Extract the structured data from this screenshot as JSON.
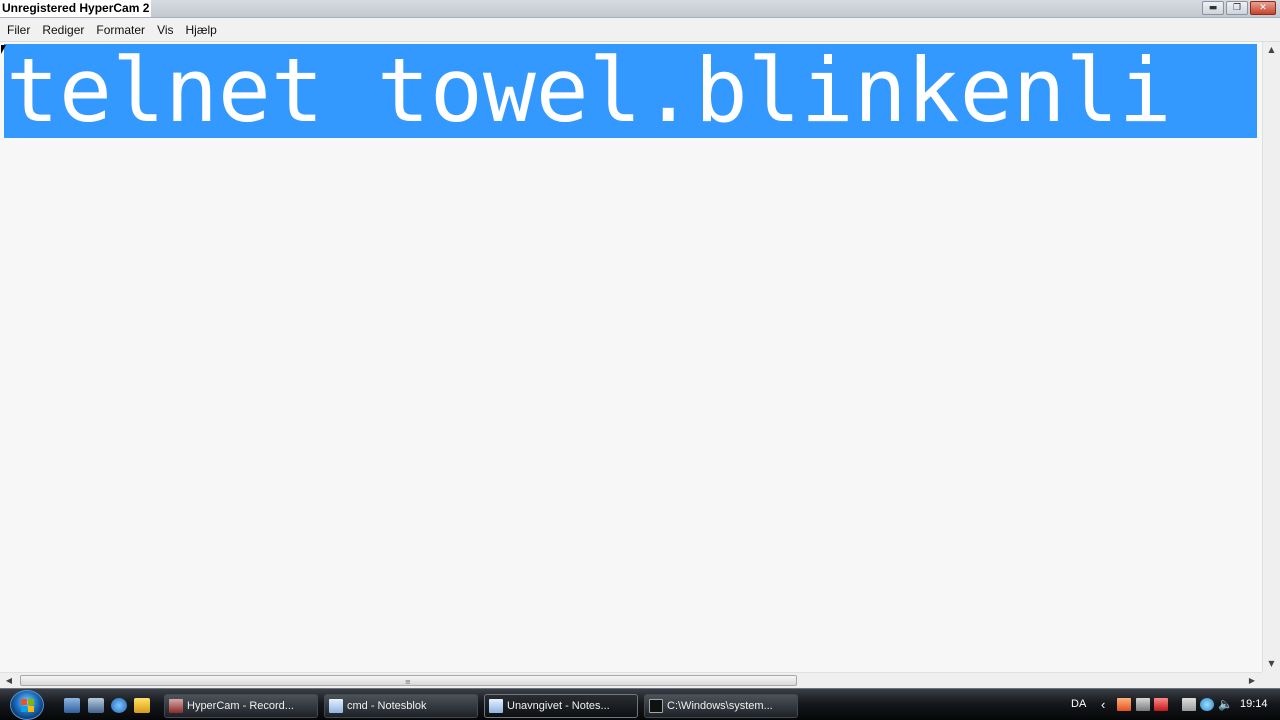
{
  "window": {
    "watermark": "Unregistered HyperCam 2",
    "controls": {
      "minimize": "▬",
      "maximize": "❐",
      "close": "✕"
    }
  },
  "menu": [
    "Filer",
    "Rediger",
    "Formater",
    "Vis",
    "Hjælp"
  ],
  "editor": {
    "text": "telnet towel.blinkenli",
    "selection_color": "#3399ff"
  },
  "scrollbars": {
    "up_arrow": "▲",
    "down_arrow": "▼",
    "left_arrow": "◀",
    "right_arrow": "▶",
    "grip": "≡"
  },
  "taskbar": {
    "tasks": [
      {
        "label": "HyperCam - Record...",
        "icon": "hypercam-icon"
      },
      {
        "label": "cmd - Notesblok",
        "icon": "notepad-icon"
      },
      {
        "label": "Unavngivet - Notes...",
        "icon": "notepad-icon",
        "active": true
      },
      {
        "label": "C:\\Windows\\system...",
        "icon": "cmd-icon"
      }
    ],
    "language": "DA",
    "tray_chevron": "‹",
    "volume_glyph": "🔈",
    "clock": "19:14"
  }
}
